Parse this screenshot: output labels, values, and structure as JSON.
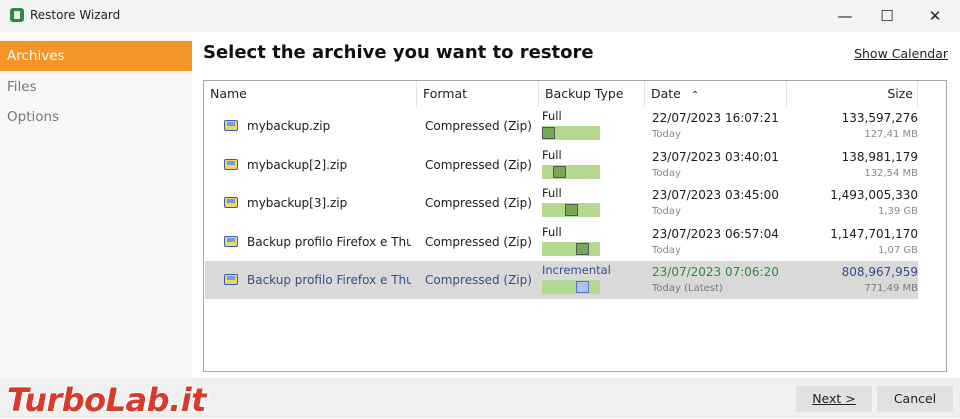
{
  "window": {
    "title": "Restore Wizard",
    "minimize": "—",
    "maximize": "☐",
    "close": "✕"
  },
  "sidebar": {
    "items": [
      {
        "label": "Archives"
      },
      {
        "label": "Files"
      },
      {
        "label": "Options"
      }
    ]
  },
  "main": {
    "heading": "Select the archive you want to restore",
    "calendar_link": "Show Calendar"
  },
  "table": {
    "columns": {
      "name": "Name",
      "format": "Format",
      "backup_type": "Backup Type",
      "date": "Date",
      "sort_arrow": "⌃",
      "size": "Size"
    },
    "rows": [
      {
        "name": "mybackup.zip",
        "format": "Compressed (Zip)",
        "type": "Full",
        "date": "22/07/2023 16:07:21",
        "date_sub": "Today",
        "size": "133,597,276",
        "size_sub": "127,41 MB",
        "marker_position": 0.0,
        "latest": false
      },
      {
        "name": "mybackup[2].zip",
        "format": "Compressed (Zip)",
        "type": "Full",
        "date": "23/07/2023 03:40:01",
        "date_sub": "Today",
        "size": "138,981,179",
        "size_sub": "132,54 MB",
        "marker_position": 0.25,
        "latest": false
      },
      {
        "name": "mybackup[3].zip",
        "format": "Compressed (Zip)",
        "type": "Full",
        "date": "23/07/2023 03:45:00",
        "date_sub": "Today",
        "size": "1,493,005,330",
        "size_sub": "1,39 GB",
        "marker_position": 0.5,
        "latest": false
      },
      {
        "name": "Backup profilo Firefox e Thun...",
        "format": "Compressed (Zip)",
        "type": "Full",
        "date": "23/07/2023 06:57:04",
        "date_sub": "Today",
        "size": "1,147,701,170",
        "size_sub": "1,07 GB",
        "marker_position": 0.75,
        "latest": false
      },
      {
        "name": "Backup profilo Firefox e Thun...",
        "format": "Compressed (Zip)",
        "type": "Incremental",
        "date": "23/07/2023 07:06:20",
        "date_sub": "Today (Latest)",
        "size": "808,967,959",
        "size_sub": "771,49 MB",
        "marker_position": 0.75,
        "latest": true,
        "selected": true
      }
    ]
  },
  "buttons": {
    "next": "Next >",
    "cancel": "Cancel"
  },
  "watermark": "TurboLab.it",
  "colors": {
    "accent": "#f39626",
    "latest_date": "#2f8a3a",
    "selected_text": "#34508a"
  }
}
